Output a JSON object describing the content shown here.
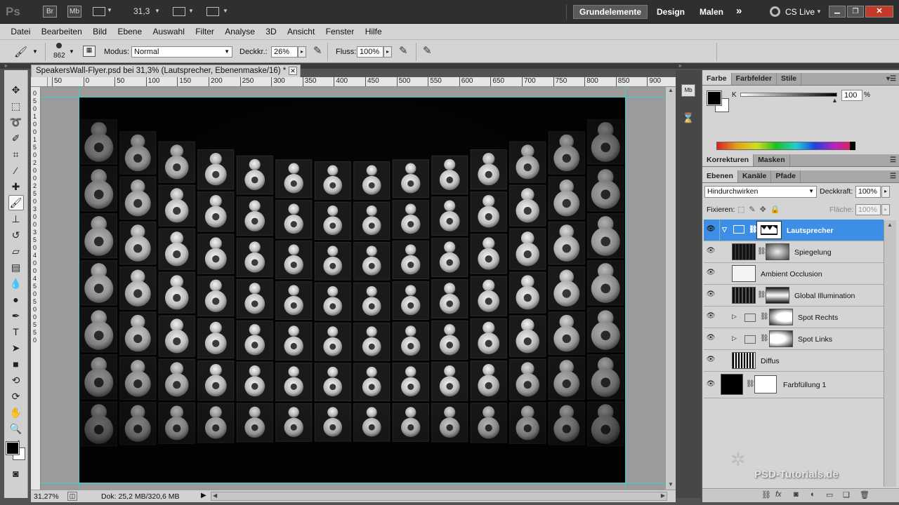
{
  "appbar": {
    "logo": "Ps",
    "bridge": "Br",
    "minibridge": "Mb",
    "zoom": "31,3",
    "workspaces": [
      "Grundelemente",
      "Design",
      "Malen"
    ],
    "more": "»",
    "cslive": "CS Live"
  },
  "menu": [
    "Datei",
    "Bearbeiten",
    "Bild",
    "Ebene",
    "Auswahl",
    "Filter",
    "Analyse",
    "3D",
    "Ansicht",
    "Fenster",
    "Hilfe"
  ],
  "options": {
    "brush_size": "862",
    "mode_label": "Modus:",
    "mode_value": "Normal",
    "opacity_label": "Deckkr.:",
    "opacity_value": "26%",
    "flow_label": "Fluss:",
    "flow_value": "100%"
  },
  "document": {
    "tab_title": "SpeakersWall-Flyer.psd bei 31,3% (Lautsprecher, Ebenenmaske/16) *",
    "ruler_labels": [
      "50",
      "0",
      "50",
      "100",
      "150",
      "200",
      "250",
      "300",
      "350",
      "400",
      "450",
      "500",
      "550",
      "600",
      "650",
      "700",
      "750",
      "800",
      "850",
      "900"
    ],
    "vruler_labels": [
      "0",
      "5",
      "0",
      "1",
      "0",
      "0",
      "1",
      "5",
      "0",
      "2",
      "0",
      "0",
      "2",
      "5",
      "0",
      "3",
      "0",
      "0",
      "3",
      "5",
      "0",
      "4",
      "0",
      "0",
      "4",
      "5",
      "0",
      "5",
      "0",
      "0",
      "5",
      "5",
      "0"
    ]
  },
  "status": {
    "zoom": "31,27%",
    "doc": "Dok: 25,2 MB/320,6 MB"
  },
  "color_panel": {
    "tabs": [
      "Farbe",
      "Farbfelder",
      "Stile"
    ],
    "channel": "K",
    "value": "100",
    "unit": "%"
  },
  "adjust_panel": {
    "tabs": [
      "Korrekturen",
      "Masken"
    ]
  },
  "layers_panel": {
    "tabs": [
      "Ebenen",
      "Kanäle",
      "Pfade"
    ],
    "blend_mode": "Hindurchwirken",
    "opacity_label": "Deckkraft:",
    "opacity_value": "100%",
    "lock_label": "Fixieren:",
    "fill_label": "Fläche:",
    "fill_value": "100%",
    "layers": [
      {
        "name": "Lautsprecher",
        "type": "group-open",
        "selected": true
      },
      {
        "name": "Spiegelung",
        "type": "layer-mask"
      },
      {
        "name": "Ambient Occlusion",
        "type": "layer"
      },
      {
        "name": "Global Illumination",
        "type": "layer-mask"
      },
      {
        "name": "Spot Rechts",
        "type": "group-closed"
      },
      {
        "name": "Spot Links",
        "type": "group-closed"
      },
      {
        "name": "Diffus",
        "type": "layer"
      },
      {
        "name": "Farbfüllung 1",
        "type": "fill"
      }
    ]
  },
  "watermark": "PSD-Tutorials.de",
  "colors": {
    "selection": "#3d8fe6",
    "guide": "#39d0d0",
    "chrome_dark": "#2f2f2f"
  }
}
